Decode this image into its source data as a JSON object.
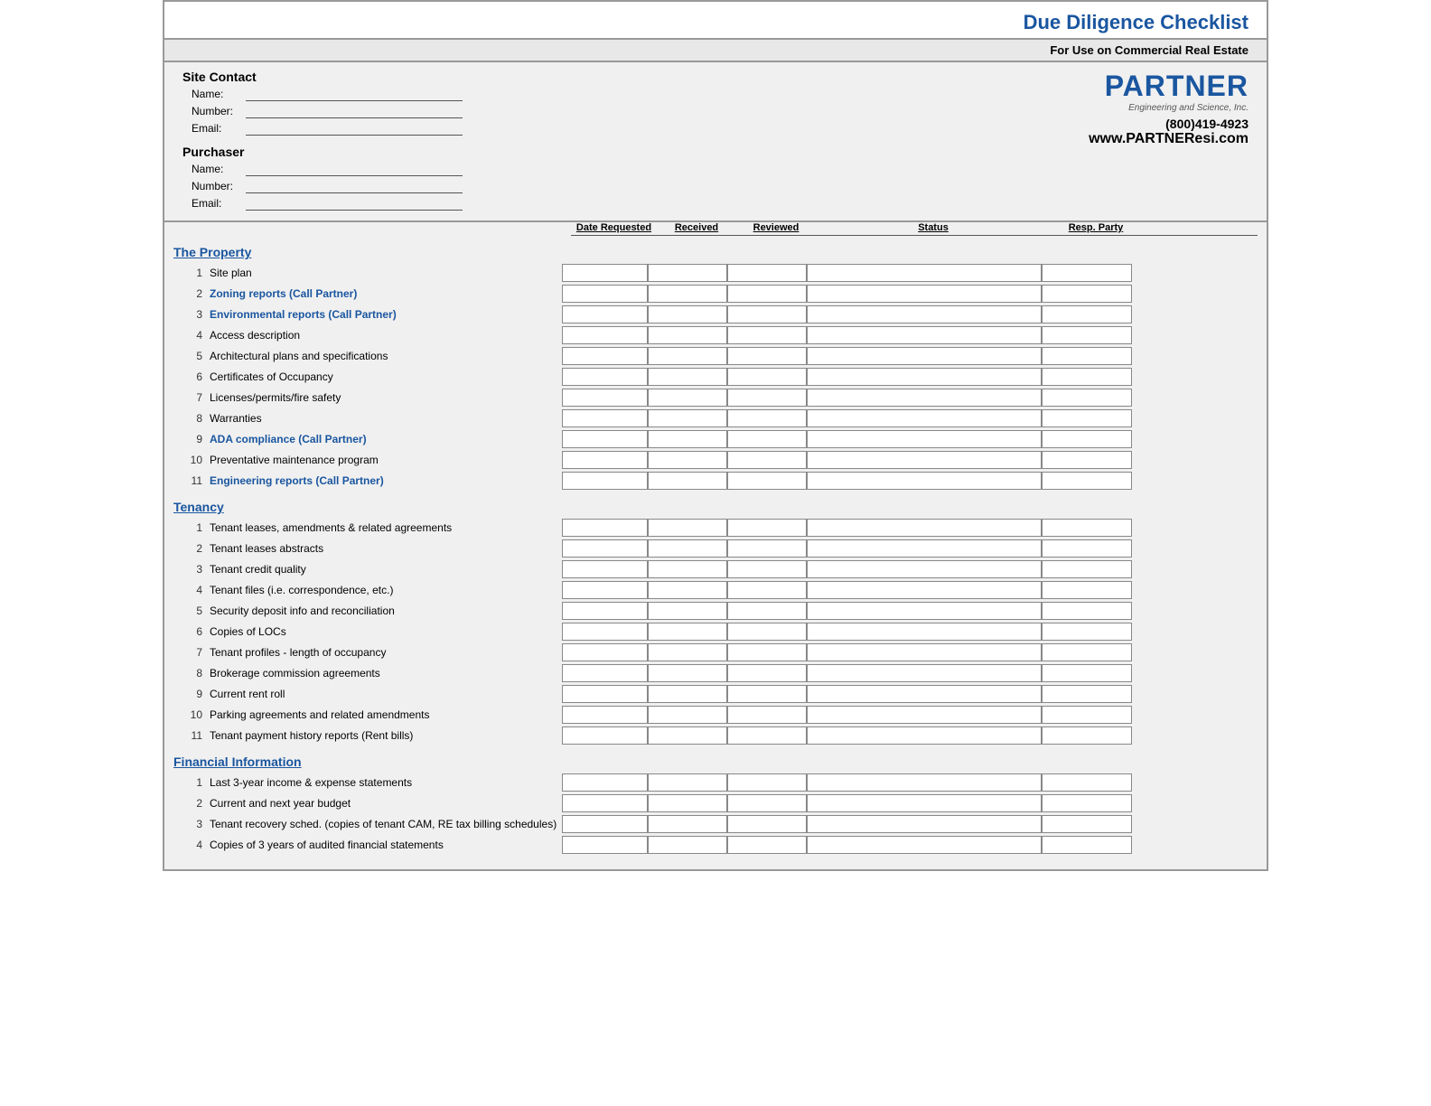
{
  "header": {
    "title": "Due Diligence Checklist",
    "subtitle": "For Use on Commercial Real Estate",
    "logo": "PARTNER",
    "logo_sub": "Engineering and Science, Inc.",
    "phone": "(800)419-4923",
    "website": "www.PARTNEResi.com"
  },
  "site_contact": {
    "label": "Site Contact",
    "name_label": "Name:",
    "number_label": "Number:",
    "email_label": "Email:"
  },
  "purchaser": {
    "label": "Purchaser",
    "name_label": "Name:",
    "number_label": "Number:",
    "email_label": "Email:"
  },
  "columns": {
    "date_requested": "Date Requested",
    "received": "Received",
    "reviewed": "Reviewed",
    "status": "Status",
    "resp_party": "Resp. Party"
  },
  "sections": [
    {
      "id": "the-property",
      "title": "The Property",
      "items": [
        {
          "num": 1,
          "label": "Site plan",
          "highlight": false
        },
        {
          "num": 2,
          "label": "Zoning reports (Call Partner)",
          "highlight": true
        },
        {
          "num": 3,
          "label": "Environmental reports (Call Partner)",
          "highlight": true
        },
        {
          "num": 4,
          "label": "Access description",
          "highlight": false
        },
        {
          "num": 5,
          "label": "Architectural plans and specifications",
          "highlight": false
        },
        {
          "num": 6,
          "label": "Certificates of Occupancy",
          "highlight": false
        },
        {
          "num": 7,
          "label": "Licenses/permits/fire safety",
          "highlight": false
        },
        {
          "num": 8,
          "label": "Warranties",
          "highlight": false
        },
        {
          "num": 9,
          "label": "ADA compliance (Call Partner)",
          "highlight": true
        },
        {
          "num": 10,
          "label": "Preventative maintenance program",
          "highlight": false
        },
        {
          "num": 11,
          "label": "Engineering reports (Call Partner)",
          "highlight": true
        }
      ]
    },
    {
      "id": "tenancy",
      "title": "Tenancy",
      "items": [
        {
          "num": 1,
          "label": "Tenant leases, amendments & related agreements",
          "highlight": false
        },
        {
          "num": 2,
          "label": "Tenant leases abstracts",
          "highlight": false
        },
        {
          "num": 3,
          "label": "Tenant credit quality",
          "highlight": false
        },
        {
          "num": 4,
          "label": "Tenant files (i.e. correspondence, etc.)",
          "highlight": false
        },
        {
          "num": 5,
          "label": "Security deposit info and reconciliation",
          "highlight": false
        },
        {
          "num": 6,
          "label": "Copies of LOCs",
          "highlight": false
        },
        {
          "num": 7,
          "label": "Tenant profiles - length of occupancy",
          "highlight": false
        },
        {
          "num": 8,
          "label": "Brokerage commission agreements",
          "highlight": false
        },
        {
          "num": 9,
          "label": "Current rent roll",
          "highlight": false
        },
        {
          "num": 10,
          "label": "Parking agreements and related amendments",
          "highlight": false
        },
        {
          "num": 11,
          "label": "Tenant payment history reports (Rent bills)",
          "highlight": false
        }
      ]
    },
    {
      "id": "financial-information",
      "title": "Financial Information",
      "items": [
        {
          "num": 1,
          "label": "Last 3-year income & expense statements",
          "highlight": false
        },
        {
          "num": 2,
          "label": "Current and next year budget",
          "highlight": false
        },
        {
          "num": 3,
          "label": "Tenant recovery sched. (copies of tenant CAM, RE tax billing schedules)",
          "highlight": false
        },
        {
          "num": 4,
          "label": "Copies of 3 years of audited financial statements",
          "highlight": false
        }
      ]
    }
  ]
}
